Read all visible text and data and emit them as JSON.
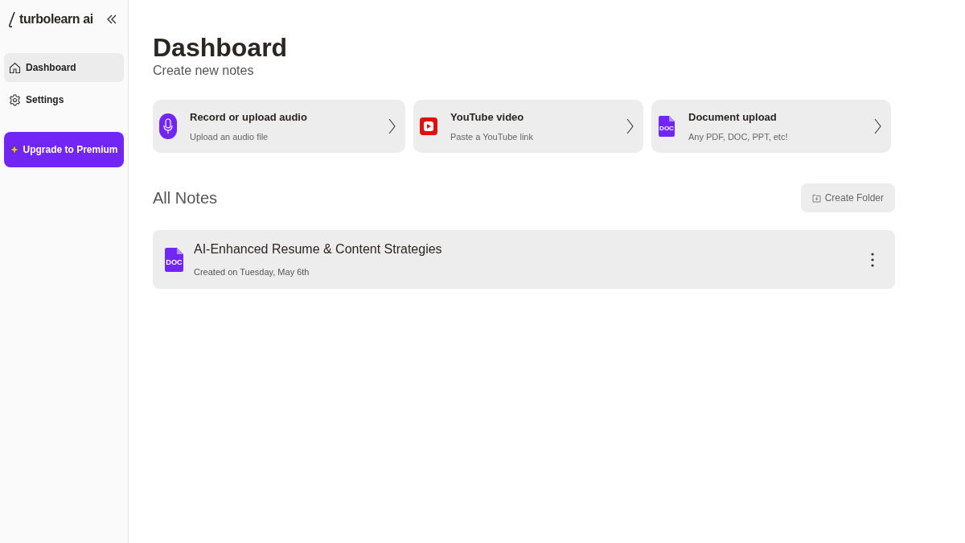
{
  "sidebar": {
    "brand": "turbolearn ai",
    "items": [
      {
        "label": "Dashboard",
        "kind": "home",
        "selected": true
      },
      {
        "label": "Settings",
        "kind": "gear",
        "selected": false
      }
    ],
    "upgrade_button": "Upgrade to Premium"
  },
  "header": {
    "title": "Dashboard",
    "subtitle": "Create new notes"
  },
  "create_cards": [
    {
      "kind": "audio",
      "title": "Record or upload audio",
      "subtitle": "Upload an audio file"
    },
    {
      "kind": "youtube",
      "title": "YouTube video",
      "subtitle": "Paste a YouTube link"
    },
    {
      "kind": "document",
      "title": "Document upload",
      "subtitle": "Any PDF, DOC, PPT, etc!",
      "icon_label": "DOC"
    }
  ],
  "notes_section": {
    "title": "All Notes",
    "create_folder_button": "Create Folder"
  },
  "notes": [
    {
      "title": "AI-Enhanced Resume & Content Strategies",
      "created": "Created on Tuesday, May 6th",
      "icon_label": "DOC"
    }
  ]
}
